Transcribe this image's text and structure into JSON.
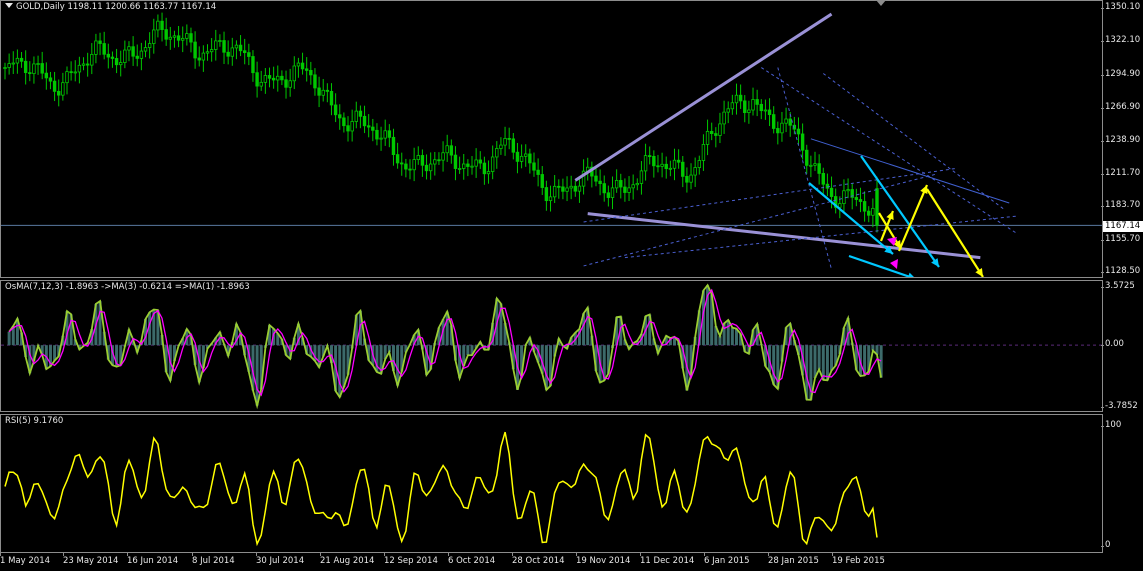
{
  "chart_window": {
    "symbol_header": "GOLD,Daily  1198.11 1200.66 1163.77 1167.14",
    "current_price": "1167.14",
    "price_axis_labels": [
      "1350.10",
      "1322.10",
      "1294.90",
      "1266.90",
      "1238.90",
      "1211.70",
      "1183.70",
      "1155.70",
      "1128.50"
    ],
    "osma_header": "OsMA(7,12,3) -1.8963  ->MA(3) -0.6214  =>MA(1) -1.8963",
    "osma_axis_labels": [
      "3.5725",
      "0.00",
      "-3.7852"
    ],
    "rsi_header": "RSI(5) 9.1760",
    "rsi_axis_labels": [
      "100",
      "0"
    ],
    "date_labels": [
      "1 May 2014",
      "23 May 2014",
      "16 Jun 2014",
      "8 Jul 2014",
      "30 Jul 2014",
      "21 Aug 2014",
      "12 Sep 2014",
      "6 Oct 2014",
      "28 Oct 2014",
      "19 Nov 2014",
      "11 Dec 2014",
      "6 Jan 2015",
      "28 Jan 2015",
      "19 Feb 2015"
    ],
    "colors": {
      "candles": "#00c800",
      "trendlines": "#9a91d6",
      "dashed": "#4a5fd0",
      "cyan_arrows": "#00c8ff",
      "yellow_arrows": "#ffff00",
      "magenta": "#ff00ff",
      "rsi": "#ffff00",
      "osma_hist": "#3c6a6a",
      "osma_ma1": "#9acd32",
      "osma_ma2": "#ff00ff"
    }
  },
  "chart_data": [
    {
      "type": "candlestick",
      "title": "GOLD,Daily",
      "ylim": [
        1122,
        1356
      ],
      "x": [
        "2014-05-01",
        "2014-05-23",
        "2014-06-16",
        "2014-07-08",
        "2014-07-30",
        "2014-08-21",
        "2014-09-12",
        "2014-10-06",
        "2014-10-28",
        "2014-11-19",
        "2014-12-11",
        "2015-01-06",
        "2015-01-28",
        "2015-02-19",
        "2015-02-26"
      ],
      "close": [
        1296,
        1294,
        1318,
        1325,
        1300,
        1285,
        1236,
        1215,
        1230,
        1196,
        1206,
        1220,
        1280,
        1215,
        1167
      ],
      "last_bar": {
        "open": 1198.11,
        "high": 1200.66,
        "low": 1163.77,
        "close": 1167.14
      }
    },
    {
      "type": "bar",
      "title": "OsMA(7,12,3)",
      "ylim": [
        -3.7852,
        3.5725
      ],
      "last_values": {
        "osma": -1.8963,
        "ma3": -0.6214,
        "ma1": -1.8963
      }
    },
    {
      "type": "line",
      "title": "RSI(5)",
      "ylim": [
        0,
        100
      ],
      "last_value": 9.176
    }
  ]
}
